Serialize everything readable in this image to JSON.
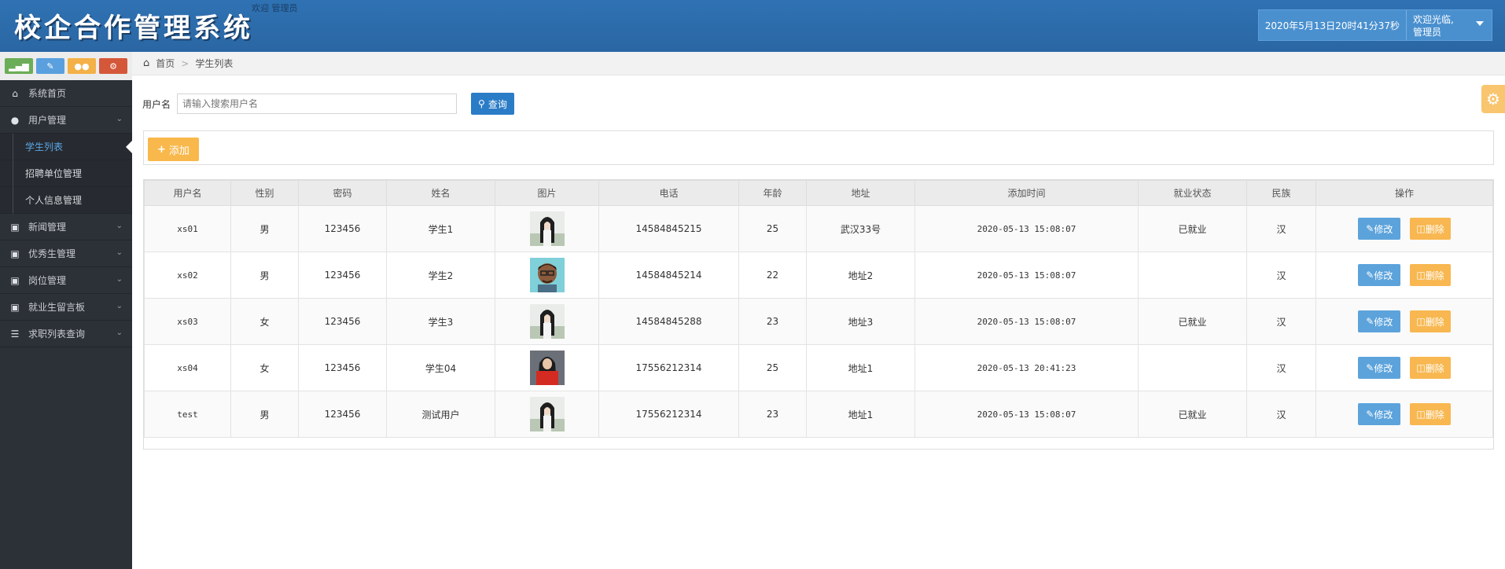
{
  "app": {
    "title": "校企合作管理系统",
    "welcome_small": "欢迎 管理员"
  },
  "header": {
    "datetime": "2020年5月13日20时41分37秒",
    "user_line1": "欢迎光临,",
    "user_line2": "管理员"
  },
  "sidebar": {
    "items": [
      {
        "label": "系统首页",
        "icon": "home-icon"
      },
      {
        "label": "用户管理",
        "icon": "user-icon"
      },
      {
        "label": "新闻管理",
        "icon": "image-icon"
      },
      {
        "label": "优秀生管理",
        "icon": "image-icon"
      },
      {
        "label": "岗位管理",
        "icon": "image-icon"
      },
      {
        "label": "就业生留言板",
        "icon": "image-icon"
      },
      {
        "label": "求职列表查询",
        "icon": "list-icon"
      }
    ],
    "sub_items": [
      "学生列表",
      "招聘单位管理",
      "个人信息管理"
    ]
  },
  "breadcrumb": {
    "home": "首页",
    "current": "学生列表"
  },
  "search": {
    "label": "用户名",
    "placeholder": "请输入搜索用户名",
    "button": "查询"
  },
  "toolbar": {
    "add_label": "添加"
  },
  "table": {
    "headers": [
      "用户名",
      "性别",
      "密码",
      "姓名",
      "图片",
      "电话",
      "年龄",
      "地址",
      "添加时间",
      "就业状态",
      "民族",
      "操作"
    ],
    "edit_label": "修改",
    "delete_label": "删除",
    "rows": [
      {
        "username": "xs01",
        "gender": "男",
        "password": "123456",
        "name": "学生1",
        "phone": "14584845215",
        "age": "25",
        "address": "武汉33号",
        "added": "2020-05-13 15:08:07",
        "status": "已就业",
        "ethnicity": "汉"
      },
      {
        "username": "xs02",
        "gender": "男",
        "password": "123456",
        "name": "学生2",
        "phone": "14584845214",
        "age": "22",
        "address": "地址2",
        "added": "2020-05-13 15:08:07",
        "status": "",
        "ethnicity": "汉"
      },
      {
        "username": "xs03",
        "gender": "女",
        "password": "123456",
        "name": "学生3",
        "phone": "14584845288",
        "age": "23",
        "address": "地址3",
        "added": "2020-05-13 15:08:07",
        "status": "已就业",
        "ethnicity": "汉"
      },
      {
        "username": "xs04",
        "gender": "女",
        "password": "123456",
        "name": "学生04",
        "phone": "17556212314",
        "age": "25",
        "address": "地址1",
        "added": "2020-05-13 20:41:23",
        "status": "",
        "ethnicity": "汉"
      },
      {
        "username": "test",
        "gender": "男",
        "password": "123456",
        "name": "测试用户",
        "phone": "17556212314",
        "age": "23",
        "address": "地址1",
        "added": "2020-05-13 15:08:07",
        "status": "已就业",
        "ethnicity": "汉"
      }
    ]
  }
}
